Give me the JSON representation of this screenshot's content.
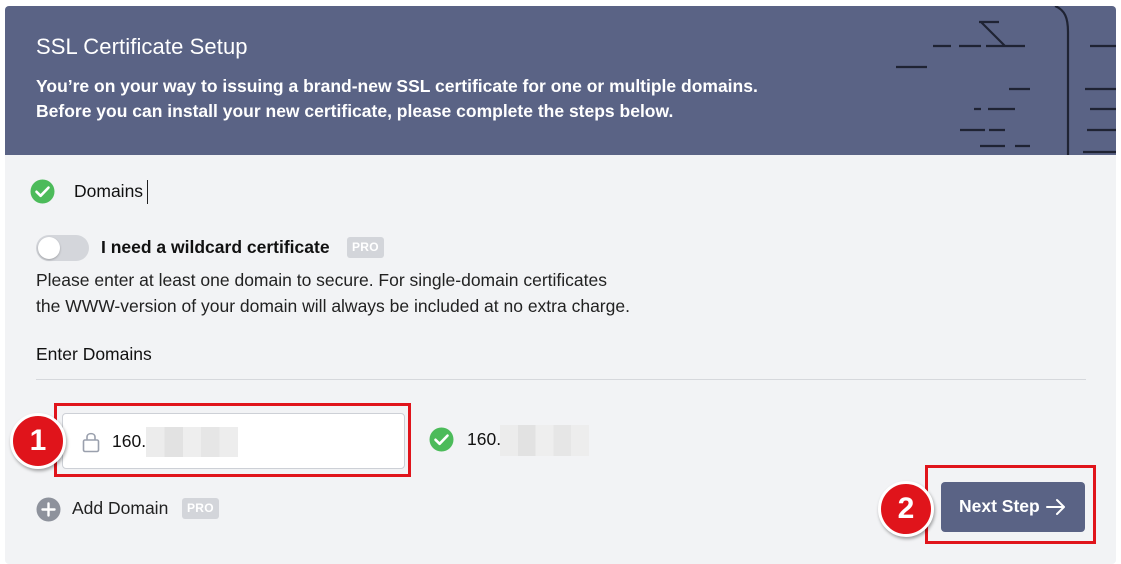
{
  "header": {
    "title": "SSL Certificate Setup",
    "description_line1": "You’re on your way to issuing a brand-new SSL certificate for one or multiple domains.",
    "description_line2": "Before you can install your new certificate, please complete the steps below."
  },
  "step": {
    "title": "Domains",
    "status_icon": "check-circle-icon"
  },
  "wildcard": {
    "label": "I need a wildcard certificate",
    "badge": "PRO",
    "enabled": false
  },
  "info": {
    "line1": "Please enter at least one domain to secure. For single-domain certificates",
    "line2": "the WWW-version of your domain will always be included at no extra charge."
  },
  "domains": {
    "section_label": "Enter Domains",
    "input_value": "160.",
    "validated_value": "160.",
    "input_icon": "lock-icon",
    "validated_icon": "check-circle-icon"
  },
  "add_domain": {
    "label": "Add Domain",
    "badge": "PRO",
    "icon": "plus-circle-icon"
  },
  "next": {
    "label": "Next Step",
    "icon": "arrow-right-icon"
  },
  "callouts": [
    "1",
    "2"
  ],
  "colors": {
    "header_bg": "#5a6385",
    "page_bg": "#f2f3f5",
    "success": "#4cbb5a",
    "callout": "#e0141b",
    "badge_bg": "#d3d5da"
  }
}
